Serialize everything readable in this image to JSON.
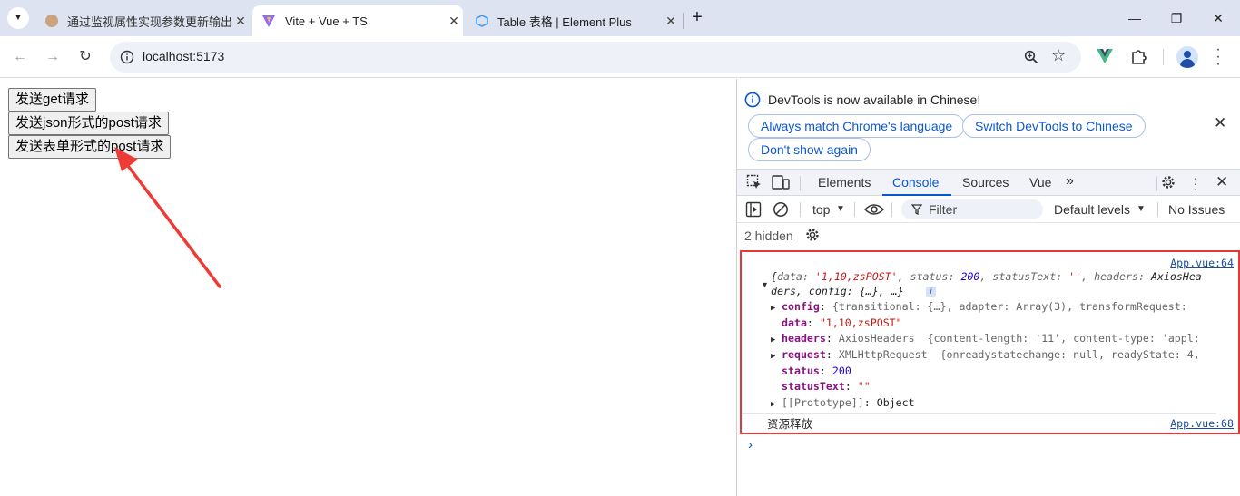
{
  "browser": {
    "tabs": [
      {
        "title": "通过监视属性实现参数更新输出",
        "active": false
      },
      {
        "title": "Vite + Vue + TS",
        "active": true
      },
      {
        "title": "Table 表格 | Element Plus",
        "active": false
      }
    ],
    "url": "localhost:5173"
  },
  "page": {
    "buttons": [
      "发送get请求",
      "发送json形式的post请求",
      "发送表单形式的post请求"
    ]
  },
  "devtools": {
    "banner": {
      "message": "DevTools is now available in Chinese!",
      "always_match": "Always match Chrome's language",
      "switch": "Switch DevTools to Chinese",
      "dont_show": "Don't show again"
    },
    "tabs": [
      "Elements",
      "Console",
      "Sources",
      "Vue"
    ],
    "active_tab": "Console",
    "console_bar": {
      "context": "top",
      "filter_placeholder": "Filter",
      "levels": "Default levels",
      "issues": "No Issues"
    },
    "hidden_label": "2 hidden",
    "log": {
      "source1": "App.vue:64",
      "summary_l1": {
        "data_key": "data",
        "data_val": "'1,10,zsPOST'",
        "status_key": "status",
        "status_val": "200",
        "statusText_key": "statusText",
        "statusText_val": "''",
        "headers_key": "headers",
        "headers_val": "AxiosHea"
      },
      "summary_l2": "ders, config: {…}, …}",
      "props": {
        "config": {
          "key": "config",
          "val": "{transitional: {…}, adapter: Array(3), transformRequest:"
        },
        "data": {
          "key": "data",
          "val": "\"1,10,zsPOST\""
        },
        "headers": {
          "key": "headers",
          "type": "AxiosHeaders",
          "val": "{content-length: '11', content-type: 'appl:"
        },
        "request": {
          "key": "request",
          "type": "XMLHttpRequest",
          "val": "{onreadystatechange: null, readyState: 4,"
        },
        "status": {
          "key": "status",
          "val": "200"
        },
        "statusText": {
          "key": "statusText",
          "val": "\"\""
        },
        "prototype": {
          "key": "[[Prototype]]",
          "val": "Object"
        }
      },
      "message2": "资源释放",
      "source2": "App.vue:68"
    }
  }
}
